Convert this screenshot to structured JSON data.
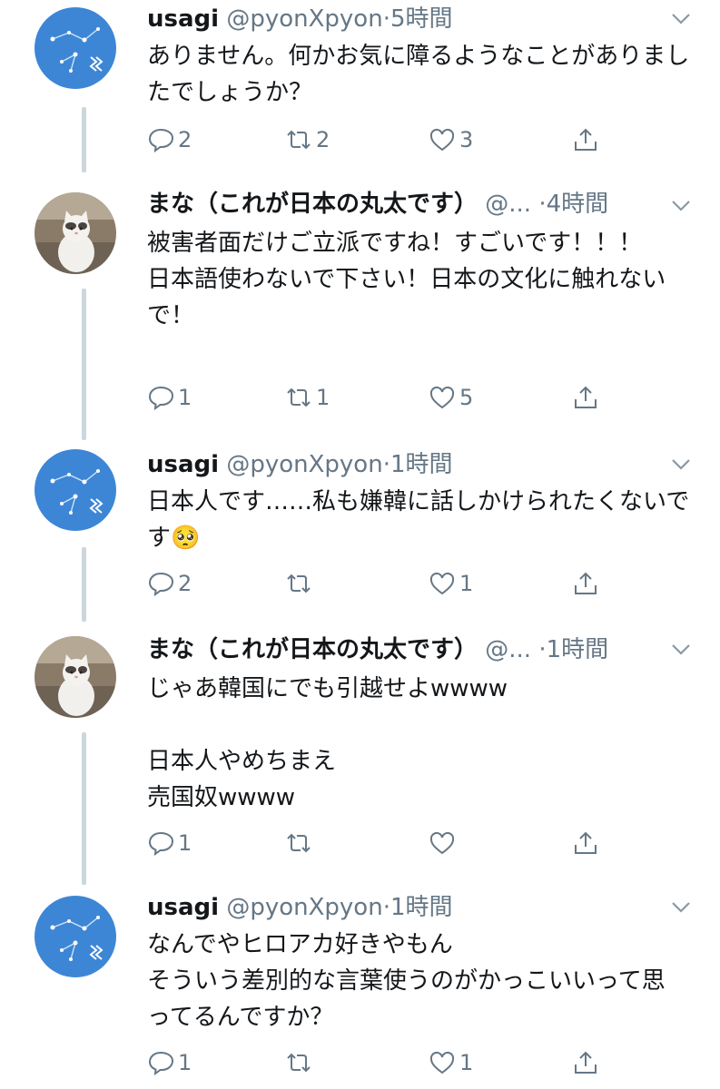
{
  "tweets": [
    {
      "name": "usagi",
      "handle": "@pyonXpyon",
      "dot": "·",
      "time": "5時間",
      "avatar": "constellation-avatar",
      "text": "ありません。何かお気に障るようなことがありましたでしょうか？",
      "reply_count": "2",
      "retweet_count": "2",
      "like_count": "3"
    },
    {
      "name": "まな（これが日本の丸太です）",
      "handle": "@...",
      "dot": "·",
      "time": "4時間",
      "avatar": "cat-avatar",
      "text": "被害者面だけご立派ですね！すごいです！！！\n日本語使わないで下さい！日本の文化に触れないで！",
      "reply_count": "1",
      "retweet_count": "1",
      "like_count": "5"
    },
    {
      "name": "usagi",
      "handle": "@pyonXpyon",
      "dot": "·",
      "time": "1時間",
      "avatar": "constellation-avatar",
      "text": "日本人です……私も嫌韓に話しかけられたくないです🥺",
      "reply_count": "2",
      "retweet_count": "",
      "like_count": "1"
    },
    {
      "name": "まな（これが日本の丸太です）",
      "handle": "@...",
      "dot": "·",
      "time": "1時間",
      "avatar": "cat-avatar",
      "text": "じゃあ韓国にでも引越せよwwww\n\n日本人やめちまえ\n売国奴wwww",
      "reply_count": "1",
      "retweet_count": "",
      "like_count": ""
    },
    {
      "name": "usagi",
      "handle": "@pyonXpyon",
      "dot": "·",
      "time": "1時間",
      "avatar": "constellation-avatar",
      "text": "なんでやヒロアカ好きやもん\nそういう差別的な言葉使うのがかっこいいって思ってるんですか？",
      "reply_count": "1",
      "retweet_count": "",
      "like_count": "1"
    }
  ],
  "colors": {
    "text": "#14171a",
    "secondary": "#657786",
    "thread_line": "#ccd6dd",
    "avatar_blue": "#3d86d6"
  }
}
